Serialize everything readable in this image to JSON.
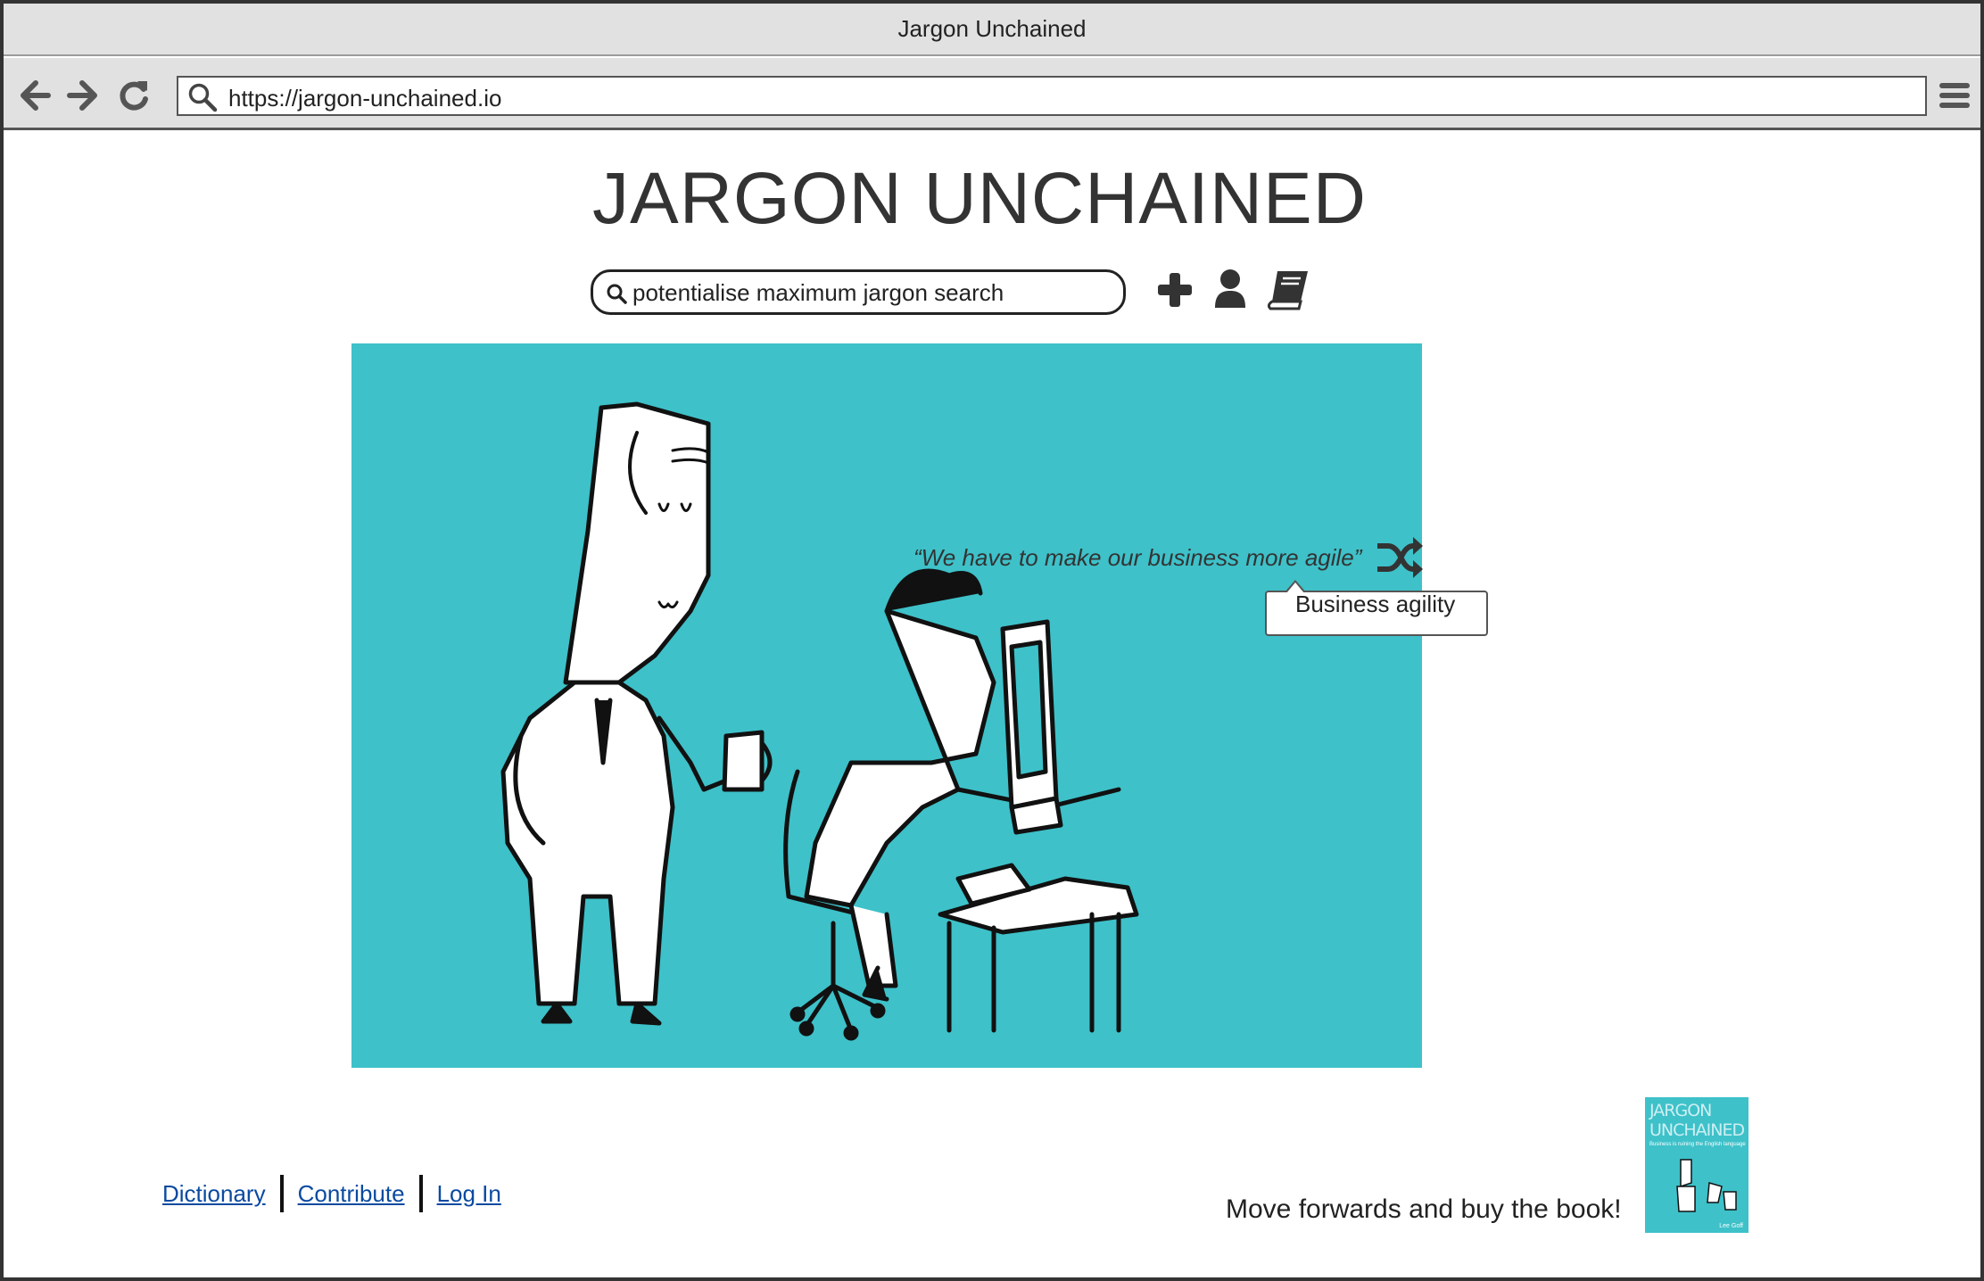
{
  "window": {
    "title": "Jargon Unchained"
  },
  "browser": {
    "url": "https://jargon-unchained.io",
    "back_icon": "arrow-left-icon",
    "forward_icon": "arrow-right-icon",
    "reload_icon": "refresh-icon",
    "search_icon": "search-icon",
    "menu_icon": "hamburger-menu-icon"
  },
  "header": {
    "site_title": "JARGON UNCHAINED",
    "search": {
      "value": "potentialise maximum jargon search",
      "placeholder": ""
    },
    "actions": [
      {
        "icon": "plus-icon"
      },
      {
        "icon": "user-icon"
      },
      {
        "icon": "book-icon"
      }
    ]
  },
  "hero": {
    "quote": "“We have to make our business more agile”",
    "shuffle_icon": "shuffle-icon",
    "tooltip": "Business agility",
    "background_color": "#3ec1c9"
  },
  "footer": {
    "links": [
      {
        "label": "Dictionary"
      },
      {
        "label": "Contribute"
      },
      {
        "label": "Log In"
      }
    ],
    "cta_text": "Move forwards and buy the book!",
    "book": {
      "title_line1": "JARGON",
      "title_line2": "UNCHAINED",
      "subtitle": "Business is ruining the English language",
      "author": "Lee Goff"
    }
  },
  "colors": {
    "accent": "#3ec1c9",
    "link": "#0a4aa0",
    "chrome": "#e1e1e1"
  }
}
